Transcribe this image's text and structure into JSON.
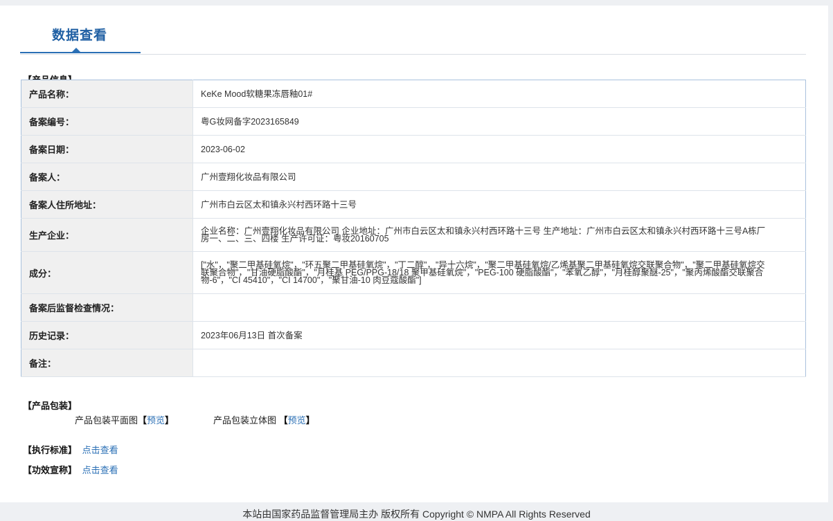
{
  "tab": {
    "title": "数据查看"
  },
  "sections": {
    "product_info": "【产品信息】",
    "packaging": "【产品包装】",
    "standard": "【执行标准】",
    "claims": "【功效宣称】"
  },
  "rows": [
    {
      "label": "产品名称：",
      "value": "KeKe Mood软糖果冻唇釉01#"
    },
    {
      "label": "备案编号：",
      "value": "粤G妆网备字2023165849"
    },
    {
      "label": "备案日期：",
      "value": "2023-06-02"
    },
    {
      "label": "备案人：",
      "value": "广州壹翔化妆品有限公司"
    },
    {
      "label": "备案人住所地址：",
      "value": "广州市白云区太和镇永兴村西环路十三号"
    },
    {
      "label": "生产企业：",
      "value": "企业名称：广州壹翔化妆品有限公司 企业地址：广州市白云区太和镇永兴村西环路十三号 生产地址：广州市白云区太和镇永兴村西环路十三号A栋厂房一、二、三、四楼 生产许可证：粤妆20160705"
    },
    {
      "label": "成分：",
      "value": "[\"水\"，\"聚二甲基硅氧烷\"，\"环五聚二甲基硅氧烷\"，\"丁二醇\"，\"异十六烷\"，\"聚二甲基硅氧烷/乙烯基聚二甲基硅氧烷交联聚合物\"，\"聚二甲基硅氧烷交联聚合物\"，\"甘油硬脂酸酯\"，\"月桂基 PEG/PPG-18/18 聚甲基硅氧烷\"，\"PEG-100 硬脂酸酯\"，\"苯氧乙醇\"，\"月桂醇聚醚-25\"，\"聚丙烯酸酯交联聚合物-6\"，\"CI 45410\"，\"CI 14700\"，\"聚甘油-10 肉豆蔻酸酯\"]"
    },
    {
      "label": "备案后监督检查情况：",
      "value": ""
    },
    {
      "label": "历史记录：",
      "value": "2023年06月13日 首次备案"
    },
    {
      "label": "备注：",
      "value": ""
    }
  ],
  "packaging": {
    "flat_label": "产品包装平面图",
    "flat_link": "预览",
    "solid_label": "产品包装立体图",
    "solid_link": "预览",
    "bracket_open": "【",
    "bracket_close": "】"
  },
  "links": {
    "standard": "点击查看",
    "claims": "点击查看"
  },
  "footer": "本站由国家药品监督管理局主办 版权所有 Copyright © NMPA All Rights Reserved"
}
